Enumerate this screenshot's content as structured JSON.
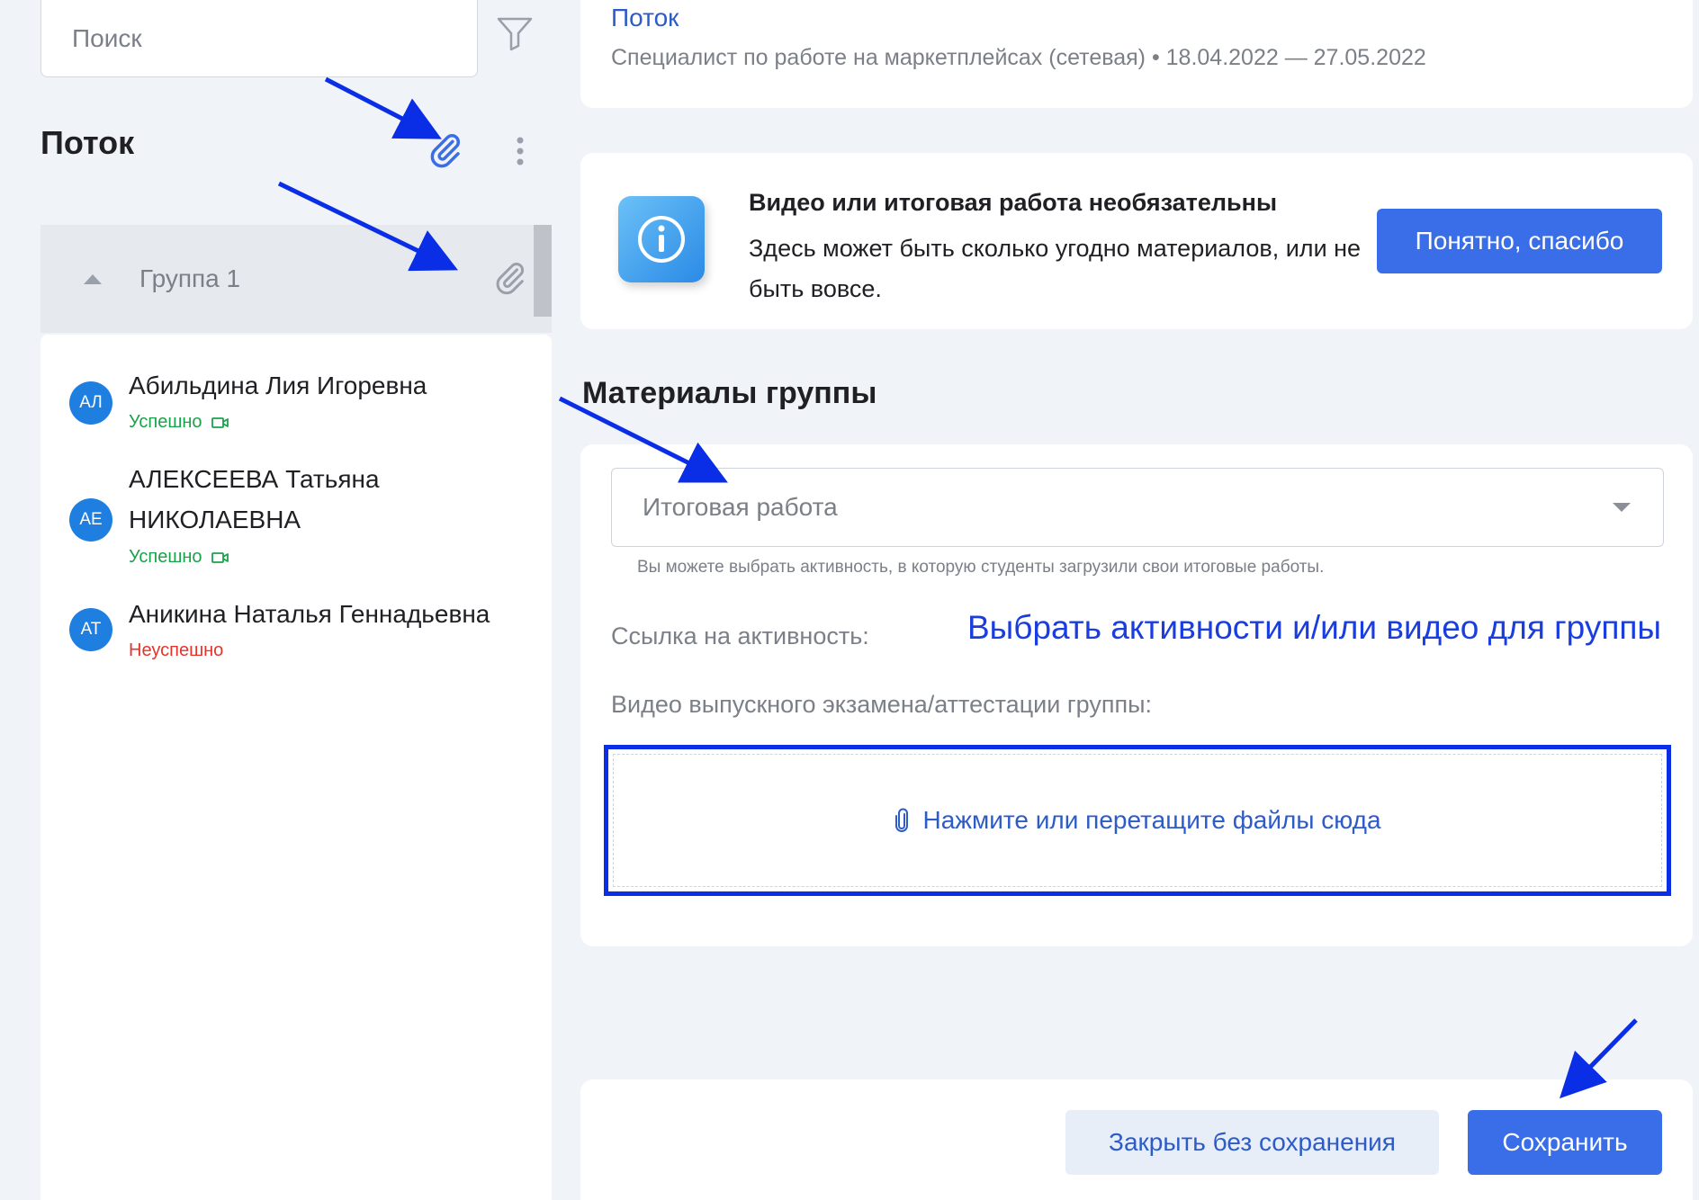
{
  "sidebar": {
    "search_placeholder": "Поиск",
    "title": "Поток",
    "group": {
      "label": "Группа 1"
    },
    "students": [
      {
        "initials": "АЛ",
        "name": "Абильдина Лия Игоревна",
        "status": "Успешно",
        "status_type": "success",
        "has_video": true
      },
      {
        "initials": "АЕ",
        "name": "АЛЕКСЕЕВА Татьяна НИКОЛАЕВНА",
        "status": "Успешно",
        "status_type": "success",
        "has_video": true
      },
      {
        "initials": "АТ",
        "name": "Аникина Наталья Геннадьевна",
        "status": "Неуспешно",
        "status_type": "fail",
        "has_video": false
      }
    ]
  },
  "header": {
    "stream_link": "Поток",
    "subtitle": "Специалист по работе на маркетплейсах (сетевая) • 18.04.2022 — 27.05.2022"
  },
  "info": {
    "title": "Видео или итоговая работа необязательны",
    "text": "Здесь может быть сколько угодно материалов, или не быть вовсе.",
    "button_label": "Понятно, спасибо"
  },
  "materials": {
    "section_title": "Материалы группы",
    "select_placeholder": "Итоговая работа",
    "hint": "Вы можете выбрать активность, в которую студенты загрузили свои итоговые работы.",
    "activity_link_label": "Ссылка на активность:",
    "annotation": "Выбрать активности и/или видео для группы",
    "video_label": "Видео выпускного экзамена/аттестации группы:",
    "upload_label": "Нажмите или перетащите файлы сюда"
  },
  "footer": {
    "close_label": "Закрыть без сохранения",
    "save_label": "Сохранить"
  },
  "colors": {
    "accent": "#3a6ee8",
    "annotation_blue": "#0a2ee6",
    "success": "#1aa34a",
    "fail": "#e5352b"
  },
  "icons": [
    "filter-icon",
    "paperclip-icon",
    "more-vertical-icon",
    "caret-up-icon",
    "video-icon",
    "info-icon",
    "chevron-down-icon"
  ]
}
